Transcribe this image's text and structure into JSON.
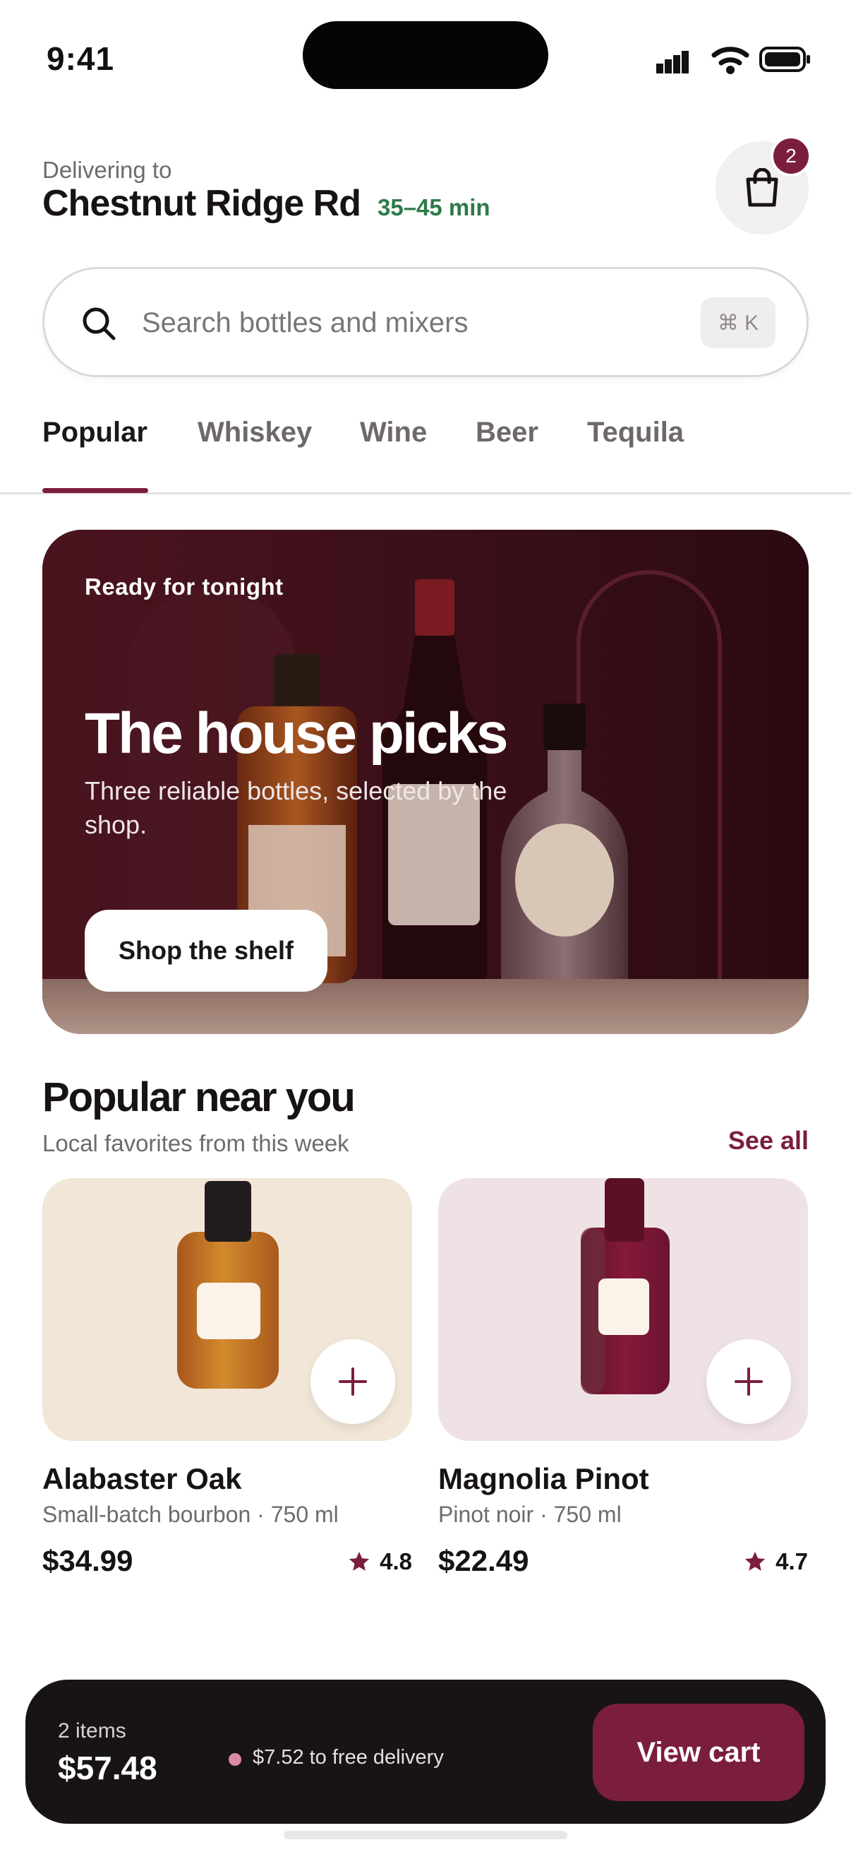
{
  "status_bar": {
    "time": "9:41"
  },
  "header": {
    "delivering_label": "Delivering to",
    "address": "Chestnut Ridge Rd",
    "eta": "35–45 min",
    "cart_count": "2",
    "cart_icon": "shopping-bag-icon"
  },
  "search": {
    "placeholder": "Search bottles and mixers",
    "shortcut": "⌘ K"
  },
  "tabs": [
    {
      "label": "Popular",
      "active": true
    },
    {
      "label": "Whiskey",
      "active": false
    },
    {
      "label": "Wine",
      "active": false
    },
    {
      "label": "Beer",
      "active": false
    },
    {
      "label": "Tequila",
      "active": false
    }
  ],
  "hero": {
    "eyebrow": "Ready for tonight",
    "title": "The house picks",
    "subtitle": "Three reliable bottles, selected by the shop.",
    "cta": "Shop the shelf"
  },
  "section": {
    "title": "Popular near you",
    "subtitle": "Local favorites from this week",
    "see_all": "See all"
  },
  "products": [
    {
      "name": "Alabaster Oak",
      "desc": "Small-batch bourbon · 750 ml",
      "price": "$34.99",
      "rating": "4.8",
      "bg": "#f1e6d8"
    },
    {
      "name": "Magnolia Pinot",
      "desc": "Pinot noir · 750 ml",
      "price": "$22.49",
      "rating": "4.7",
      "bg": "#efe2e5"
    }
  ],
  "cart_bar": {
    "items": "2 items",
    "total": "$57.48",
    "free_delivery": "$7.52 to free delivery",
    "cta": "View cart"
  },
  "colors": {
    "accent": "#7b1e3c",
    "eta_green": "#2e7a4a",
    "cart_bar_bg": "#181416"
  }
}
